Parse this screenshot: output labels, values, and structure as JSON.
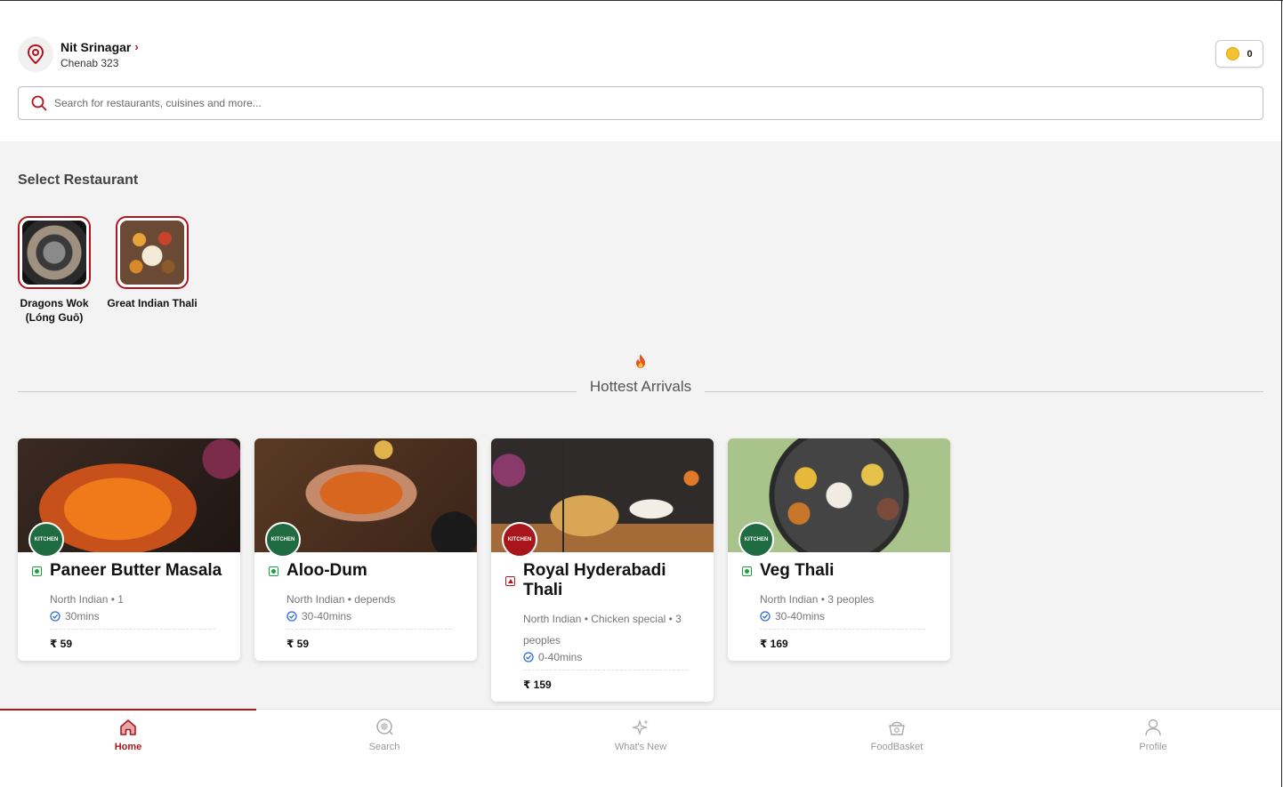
{
  "header": {
    "location_title": "Nit Srinagar",
    "location_sub": "Chenab 323",
    "coins": "0",
    "search_placeholder": "Search for restaurants, cuisines and more..."
  },
  "restaurants": {
    "title": "Select Restaurant",
    "items": [
      {
        "name": "Dragons Wok (Lóng Guō)"
      },
      {
        "name": "Great Indian Thali"
      }
    ]
  },
  "hottest": {
    "title": "Hottest Arrivals",
    "cards": [
      {
        "title": "Paneer Butter Masala",
        "meta": "North Indian • 1",
        "time": "30mins",
        "price": "₹ 59",
        "type": "veg"
      },
      {
        "title": "Aloo-Dum",
        "meta": "North Indian • depends",
        "time": "30-40mins",
        "price": "₹ 59",
        "type": "veg"
      },
      {
        "title": "Royal Hyderabadi Thali",
        "meta": "North Indian • Chicken special • 3 peoples",
        "time": "0-40mins",
        "price": "₹ 159",
        "type": "nonveg"
      },
      {
        "title": "Veg Thali",
        "meta": "North Indian • 3 peoples",
        "time": "30-40mins",
        "price": "₹ 169",
        "type": "veg"
      }
    ]
  },
  "nav": {
    "items": [
      {
        "label": "Home",
        "icon": "home-icon"
      },
      {
        "label": "Search",
        "icon": "search-icon"
      },
      {
        "label": "What's New",
        "icon": "sparkle-icon"
      },
      {
        "label": "FoodBasket",
        "icon": "basket-icon"
      },
      {
        "label": "Profile",
        "icon": "profile-icon"
      }
    ]
  },
  "colors": {
    "brand": "#b1151d",
    "veg": "#1e9e3e",
    "time": "#2c6bd8"
  }
}
